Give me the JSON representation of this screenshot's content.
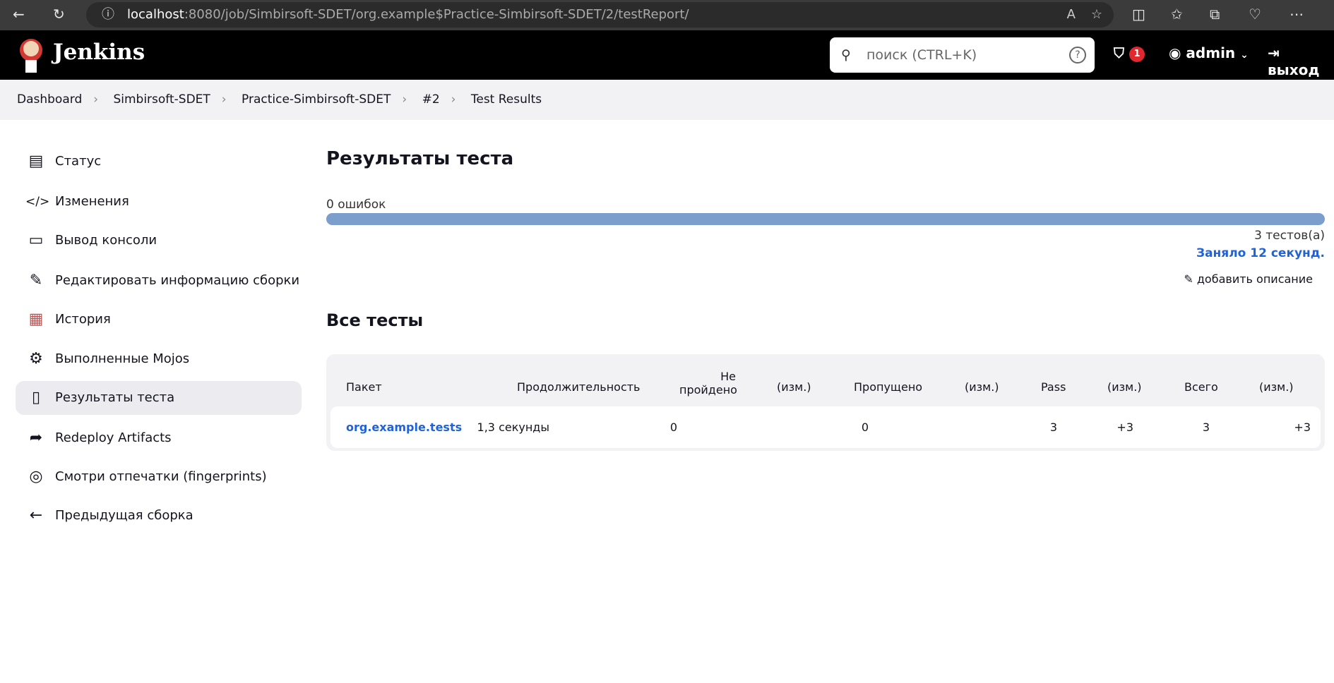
{
  "browser": {
    "url_host": "localhost",
    "url_rest": ":8080/job/Simbirsoft-SDET/org.example$Practice-Simbirsoft-SDET/2/testReport/"
  },
  "header": {
    "brand": "Jenkins",
    "search_placeholder": "поиск (CTRL+K)",
    "security_count": "1",
    "user": "admin",
    "logout": "выход"
  },
  "breadcrumb": [
    "Dashboard",
    "Simbirsoft-SDET",
    "Practice-Simbirsoft-SDET",
    "#2",
    "Test Results"
  ],
  "sidebar": {
    "items": [
      {
        "label": "Статус",
        "icon": "document-icon"
      },
      {
        "label": "Изменения",
        "icon": "code-icon"
      },
      {
        "label": "Вывод консоли",
        "icon": "terminal-icon"
      },
      {
        "label": "Редактировать информацию сборки",
        "icon": "edit-icon"
      },
      {
        "label": "История",
        "icon": "history-chart-icon"
      },
      {
        "label": "Выполненные Mojos",
        "icon": "gear-icon"
      },
      {
        "label": "Результаты теста",
        "icon": "clipboard-icon",
        "active": true
      },
      {
        "label": "Redeploy Artifacts",
        "icon": "redeploy-icon"
      },
      {
        "label": "Смотри отпечатки (fingerprints)",
        "icon": "fingerprint-icon"
      },
      {
        "label": "Предыдущая сборка",
        "icon": "arrow-left-icon"
      }
    ]
  },
  "main": {
    "title": "Результаты теста",
    "failures": "0 ошибок",
    "pass_fraction": 1.0,
    "tests": "3 тестов(а)",
    "duration": "Заняло 12 секунд.",
    "add_description": "добавить описание",
    "all_tests": "Все тесты"
  },
  "table": {
    "headers": [
      "Пакет",
      "Продолжительность",
      "Не пройдено",
      "(изм.)",
      "Пропущено",
      "(изм.)",
      "Pass",
      "(изм.)",
      "Всего",
      "(изм.)"
    ],
    "rows": [
      {
        "package": "org.example.tests",
        "duration": "1,3 секунды",
        "failed": "0",
        "failed_diff": "",
        "skipped": "0",
        "skipped_diff": "",
        "pass": "3",
        "pass_diff": "+3",
        "total": "3",
        "total_diff": "+3"
      }
    ]
  },
  "colors": {
    "accent": "#2062d9",
    "bar": "#7b9ecc"
  }
}
